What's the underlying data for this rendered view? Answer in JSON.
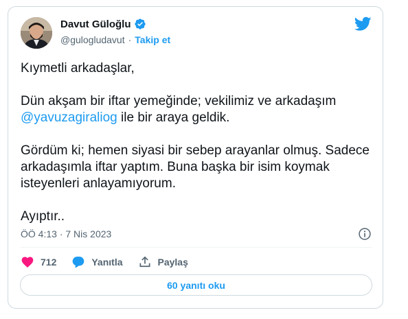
{
  "author": {
    "name": "Davut Güloğlu",
    "handle": "@guloglud avut",
    "handle_text": "@gulogludavut",
    "separator": "·",
    "follow_label": "Takip et"
  },
  "tweet": {
    "line1": "Kıymetli arkadaşlar,",
    "para2_text": "Dün akşam bir iftar yemeğinde; vekilimiz ve arkadaşım",
    "mention": "@yavuzagiraliog",
    "para2_tail": " ile bir araya geldik.",
    "para3": "Gördüm ki; hemen siyasi bir sebep arayanlar olmuş. Sadece arkadaşımla iftar yaptım. Buna başka bir isim koymak isteyenleri anlayamıyorum.",
    "line4": "Ayıptır.."
  },
  "meta": {
    "time": "ÖÖ 4:13",
    "separator": "·",
    "date": "7 Nis 2023"
  },
  "actions": {
    "like_count": "712",
    "reply_label": "Yanıtla",
    "share_label": "Paylaş"
  },
  "replies_button": "60 yanıtı oku",
  "colors": {
    "accent": "#1d9bf0",
    "like": "#f91880",
    "text": "#0f1419",
    "secondary": "#536471"
  }
}
